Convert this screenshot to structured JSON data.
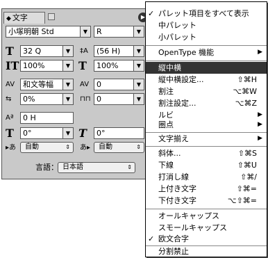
{
  "palette": {
    "tab_label": "文字",
    "menu_button": "▶",
    "font_family": "小塚明朝 Std",
    "font_style": "R",
    "size": "32 Q",
    "leading": "(56 H)",
    "vscale": "100%",
    "hscale": "100%",
    "kerning": "和文等幅",
    "tracking": "0",
    "tsume": "0%",
    "aki": "0",
    "baseline": "0 H",
    "rotate": "0°",
    "skew": "0°",
    "aki_before": "自動",
    "aki_after": "自動",
    "language_label": "言語：",
    "language": "日本語"
  },
  "menu": {
    "items": [
      {
        "label": "パレット項目をすべて表示",
        "check": "✓"
      },
      {
        "label": "中パレット"
      },
      {
        "label": "小パレット"
      },
      {
        "label": "OpenType 機能",
        "sub": "▶"
      },
      {
        "label": "縦中横"
      },
      {
        "label": "縦中横設定...",
        "shortcut": "⇧⌘H"
      },
      {
        "label": "割注",
        "shortcut": "⌥⌘W"
      },
      {
        "label": "割注設定...",
        "shortcut": "⌥⌘Z"
      },
      {
        "label": "ルビ",
        "sub": "▶"
      },
      {
        "label": "圏点",
        "sub": "▶"
      },
      {
        "label": "文字揃え",
        "sub": "▶"
      },
      {
        "label": "斜体...",
        "shortcut": "⇧⌘S"
      },
      {
        "label": "下線",
        "shortcut": "⇧⌘U"
      },
      {
        "label": "打消し線",
        "shortcut": "⇧⌘/"
      },
      {
        "label": "上付き文字",
        "shortcut": "⇧⌘="
      },
      {
        "label": "下付き文字",
        "shortcut": "⌥⇧⌘="
      },
      {
        "label": "オールキャップス"
      },
      {
        "label": "スモールキャップス"
      },
      {
        "label": "欧文合字",
        "check": "✓"
      },
      {
        "label": "分割禁止"
      }
    ]
  }
}
